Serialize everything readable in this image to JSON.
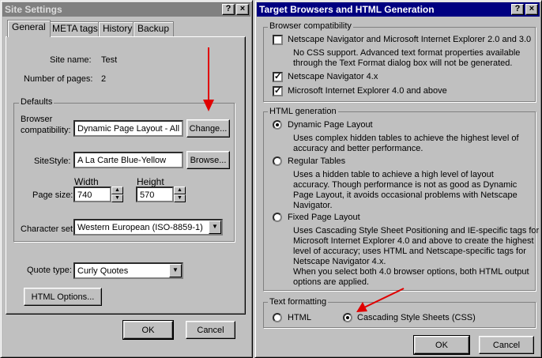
{
  "site_settings": {
    "title": "Site Settings",
    "help_button": "?",
    "close_button": "×",
    "tabs": [
      "General",
      "META tags",
      "History",
      "Backup"
    ],
    "site_name_label": "Site name:",
    "site_name_value": "Test",
    "pages_label": "Number of pages:",
    "pages_value": "2",
    "defaults_label": "Defaults",
    "browser_label_1": "Browser",
    "browser_label_2": "compatibility:",
    "browser_value": "Dynamic Page Layout - All",
    "change_button": "Change...",
    "sitestyle_label": "SiteStyle:",
    "sitestyle_value": "A La Carte Blue-Yellow",
    "browse_button": "Browse...",
    "width_label": "Width",
    "height_label": "Height",
    "page_size_label": "Page size:",
    "width_value": "740",
    "height_value": "570",
    "charset_label": "Character set:",
    "charset_value": "Western European (ISO-8859-1)",
    "quote_label": "Quote type:",
    "quote_value": "Curly Quotes",
    "html_options_button": "HTML Options...",
    "ok_button": "OK",
    "cancel_button": "Cancel"
  },
  "target_browsers": {
    "title": "Target Browsers and HTML Generation",
    "help_button": "?",
    "close_button": "×",
    "compat_group": "Browser compatibility",
    "compat_opt1": "Netscape Navigator and Microsoft Internet Explorer 2.0 and 3.0",
    "compat_opt1_desc": [
      "No CSS support. Advanced text format properties available",
      "through the Text Format dialog box will not be generated."
    ],
    "compat_opt2": "Netscape Navigator 4.x",
    "compat_opt3": "Microsoft Internet Explorer 4.0 and above",
    "html_group": "HTML generation",
    "dpl_label": "Dynamic Page Layout",
    "dpl_desc": [
      "Uses complex hidden tables to achieve the highest level of",
      "accuracy and better performance."
    ],
    "rt_label": "Regular Tables",
    "rt_desc": [
      "Uses a hidden table to achieve a high level of layout",
      "accuracy. Though performance is not as good as Dynamic",
      "Page Layout, it avoids occasional problems with Netscape",
      "Navigator."
    ],
    "fpl_label": "Fixed Page Layout",
    "fpl_desc": [
      "Uses Cascading Style Sheet Positioning and IE-specific tags for",
      "Microsoft Internet Explorer 4.0 and above to create the highest",
      "level of accuracy; uses HTML and Netscape-specific tags for",
      "Netscape Navigator 4.x.",
      "When you select both 4.0 browser options, both HTML output",
      "options are applied."
    ],
    "text_group": "Text formatting",
    "html_radio": "HTML",
    "css_radio": "Cascading Style Sheets (CSS)",
    "ok_button": "OK",
    "cancel_button": "Cancel"
  },
  "colors": {
    "arrow": "#e00000",
    "active_title": "#000080",
    "inactive_title": "#808080"
  },
  "icons": {
    "check": "✓",
    "dropdown": "▼",
    "spin_up": "▲",
    "spin_down": "▼"
  }
}
